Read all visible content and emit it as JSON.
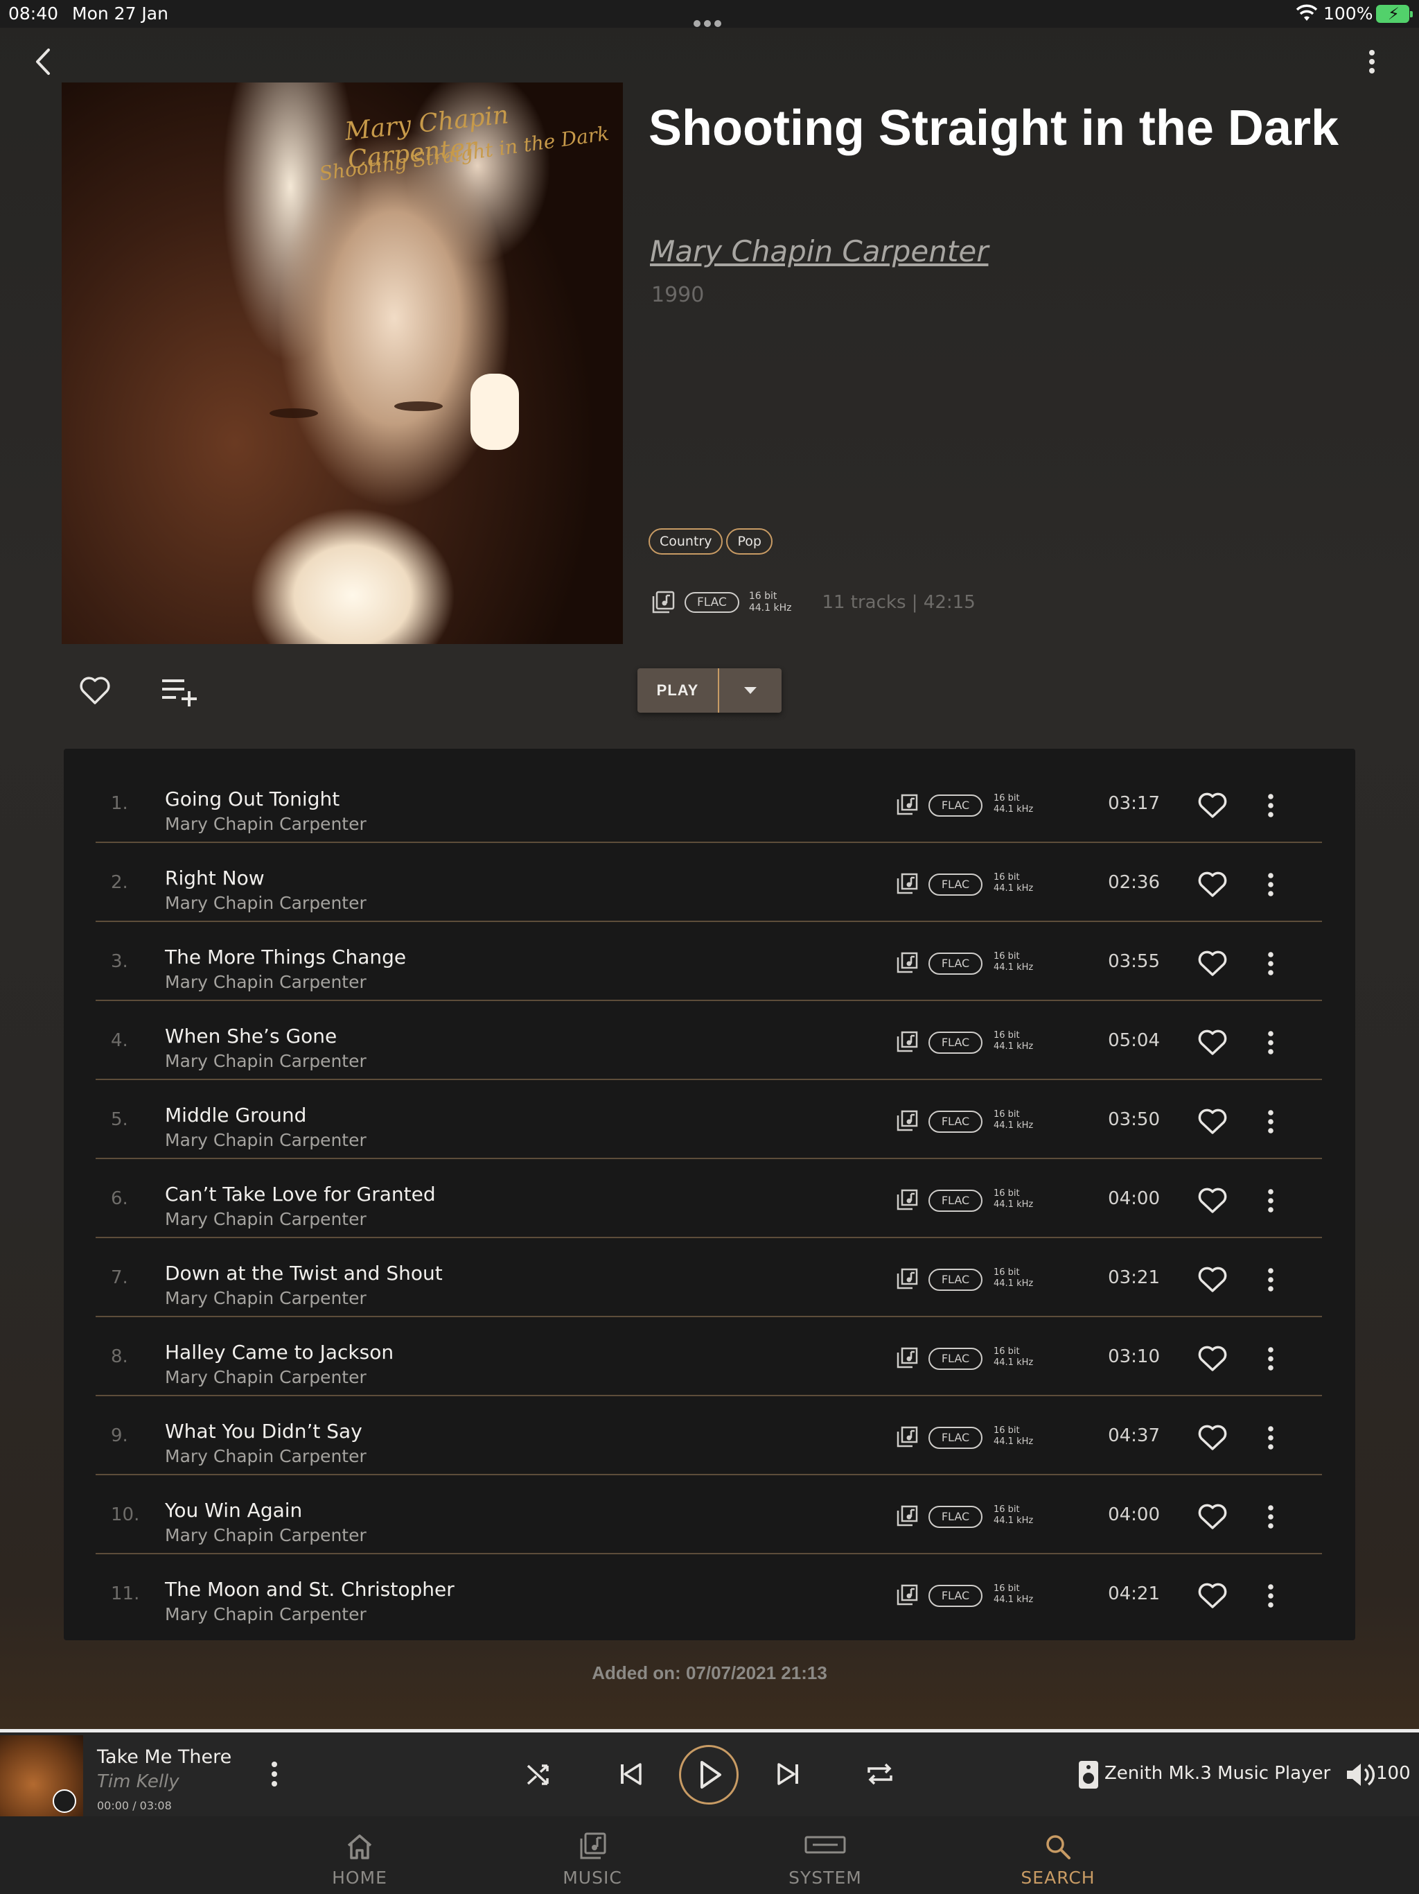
{
  "status": {
    "time": "08:40",
    "date": "Mon 27 Jan",
    "battery": "100%"
  },
  "album": {
    "title": "Shooting Straight in the Dark",
    "artist": "Mary Chapin Carpenter",
    "year": "1990",
    "cover_artist_text": "Mary Chapin Carpenter",
    "cover_title_text": "Shooting Straight in the Dark",
    "genres": [
      "Country",
      "Pop"
    ],
    "format": "FLAC",
    "bit_depth": "16 bit",
    "sample_rate": "44.1 kHz",
    "summary": "11 tracks | 42:15",
    "play_label": "PLAY",
    "added": "Added on: 07/07/2021 21:13"
  },
  "tracks": [
    {
      "num": "1.",
      "title": "Going Out Tonight",
      "artist": "Mary Chapin Carpenter",
      "format": "FLAC",
      "bits": "16 bit",
      "rate": "44.1 kHz",
      "duration": "03:17"
    },
    {
      "num": "2.",
      "title": "Right Now",
      "artist": "Mary Chapin Carpenter",
      "format": "FLAC",
      "bits": "16 bit",
      "rate": "44.1 kHz",
      "duration": "02:36"
    },
    {
      "num": "3.",
      "title": "The More Things Change",
      "artist": "Mary Chapin Carpenter",
      "format": "FLAC",
      "bits": "16 bit",
      "rate": "44.1 kHz",
      "duration": "03:55"
    },
    {
      "num": "4.",
      "title": "When She’s Gone",
      "artist": "Mary Chapin Carpenter",
      "format": "FLAC",
      "bits": "16 bit",
      "rate": "44.1 kHz",
      "duration": "05:04"
    },
    {
      "num": "5.",
      "title": "Middle Ground",
      "artist": "Mary Chapin Carpenter",
      "format": "FLAC",
      "bits": "16 bit",
      "rate": "44.1 kHz",
      "duration": "03:50"
    },
    {
      "num": "6.",
      "title": "Can’t Take Love for Granted",
      "artist": "Mary Chapin Carpenter",
      "format": "FLAC",
      "bits": "16 bit",
      "rate": "44.1 kHz",
      "duration": "04:00"
    },
    {
      "num": "7.",
      "title": "Down at the Twist and Shout",
      "artist": "Mary Chapin Carpenter",
      "format": "FLAC",
      "bits": "16 bit",
      "rate": "44.1 kHz",
      "duration": "03:21"
    },
    {
      "num": "8.",
      "title": "Halley Came to Jackson",
      "artist": "Mary Chapin Carpenter",
      "format": "FLAC",
      "bits": "16 bit",
      "rate": "44.1 kHz",
      "duration": "03:10"
    },
    {
      "num": "9.",
      "title": "What You Didn’t Say",
      "artist": "Mary Chapin Carpenter",
      "format": "FLAC",
      "bits": "16 bit",
      "rate": "44.1 kHz",
      "duration": "04:37"
    },
    {
      "num": "10.",
      "title": "You Win Again",
      "artist": "Mary Chapin Carpenter",
      "format": "FLAC",
      "bits": "16 bit",
      "rate": "44.1 kHz",
      "duration": "04:00"
    },
    {
      "num": "11.",
      "title": "The Moon and St. Christopher",
      "artist": "Mary Chapin Carpenter",
      "format": "FLAC",
      "bits": "16 bit",
      "rate": "44.1 kHz",
      "duration": "04:21"
    }
  ],
  "now_playing": {
    "title": "Take Me There",
    "artist": "Tim Kelly",
    "time": "00:00 / 03:08",
    "device": "Zenith Mk.3 Music Player",
    "volume": "100"
  },
  "tabs": [
    {
      "label": "HOME",
      "icon": "home-icon"
    },
    {
      "label": "MUSIC",
      "icon": "music-library-icon"
    },
    {
      "label": "SYSTEM",
      "icon": "system-device-icon"
    },
    {
      "label": "SEARCH",
      "icon": "search-icon",
      "active": true
    }
  ],
  "colors": {
    "accent": "#c89b64",
    "background": "#262523",
    "list_bg": "#181818"
  }
}
